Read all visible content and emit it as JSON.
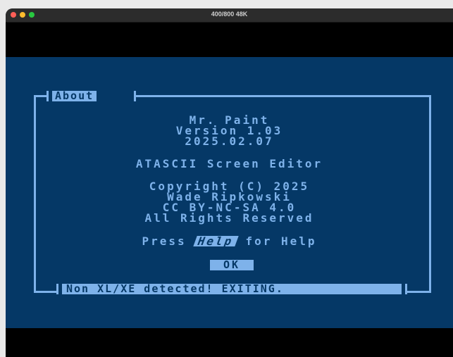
{
  "window": {
    "title": "400/800 48K"
  },
  "dialog": {
    "title": "About",
    "app_name": "Mr. Paint",
    "version": "Version 1.03",
    "date": "2025.02.07",
    "subtitle": "ATASCII Screen Editor",
    "copyright": "Copyright (C) 2025",
    "author": "Wade Ripkowski",
    "license": "CC BY-NC-SA 4.0",
    "rights": "All Rights Reserved",
    "press_prefix": "Press ",
    "help_key": "Help",
    "press_suffix": " for Help",
    "ok_label": "OK",
    "status": "Non XL/XE detected! EXITING."
  },
  "colors": {
    "screen_bg": "#053866",
    "foreground": "#7eb2ea",
    "border": "#7eb2ea"
  }
}
